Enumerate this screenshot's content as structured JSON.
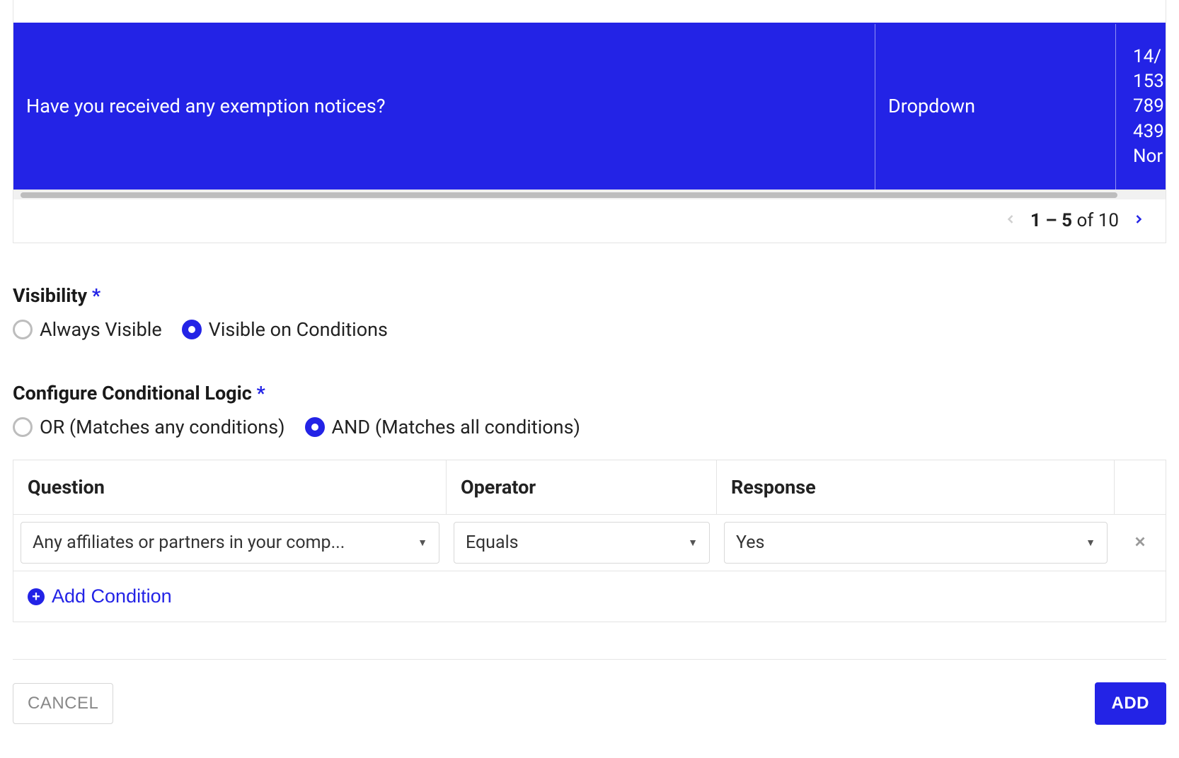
{
  "table": {
    "selected_row": {
      "question": "Have you received any exemption notices?",
      "type": "Dropdown",
      "values": [
        "14/",
        "153",
        "789",
        "439",
        "Nor"
      ]
    },
    "pager": {
      "range_bold": "1 – 5",
      "range_rest": " of 10"
    }
  },
  "visibility": {
    "label": "Visibility",
    "asterisk": "*",
    "options": {
      "always": "Always Visible",
      "conditional": "Visible on Conditions"
    },
    "selected": "conditional"
  },
  "logic": {
    "label": "Configure Conditional Logic",
    "asterisk": "*",
    "options": {
      "or": "OR (Matches any conditions)",
      "and": "AND (Matches all conditions)"
    },
    "selected": "and"
  },
  "conditions": {
    "headers": {
      "question": "Question",
      "operator": "Operator",
      "response": "Response"
    },
    "rows": [
      {
        "question": "Any affiliates or partners in your comp...",
        "operator": "Equals",
        "response": "Yes"
      }
    ],
    "add_label": "Add Condition"
  },
  "footer": {
    "cancel": "CANCEL",
    "add": "ADD"
  }
}
